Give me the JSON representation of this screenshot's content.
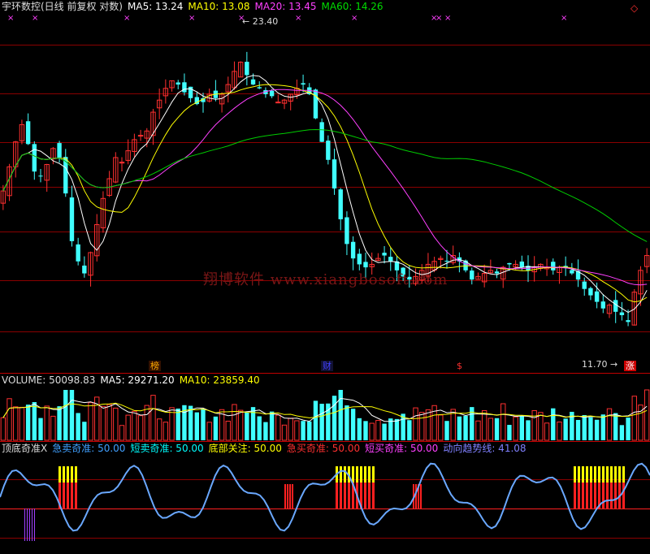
{
  "main": {
    "stock_title": "宇环数控(日线 前复权 对数)",
    "ma5_label": "MA5: 13.24",
    "ma10_label": "MA10: 13.08",
    "ma20_label": "MA20: 13.45",
    "ma60_label": "MA60: 14.26",
    "high_label": "23.40",
    "low_label": "11.70",
    "watermark": "翔博软件 www.xiangbosoft.com",
    "tag_bang": "榜",
    "tag_cai": "财",
    "tag_s": "$",
    "tag_zhang": "涨",
    "x_marker": "×",
    "colors": {
      "up": "#ff3030",
      "down": "#40ffff",
      "ma5": "#ffffff",
      "ma10": "#ffff00",
      "ma20": "#ff40ff",
      "ma60": "#00cc00"
    }
  },
  "volume": {
    "volume_label": "VOLUME: 50098.83",
    "ma5_label": "MA5: 29271.20",
    "ma10_label": "MA10: 23859.40"
  },
  "indicator": {
    "name_label": "顶底奇准X",
    "l1": "急卖奇准: 50.00",
    "l2": "短卖奇准: 50.00",
    "l3": "底部关注: 50.00",
    "l4": "急买奇准: 50.00",
    "l5": "短买奇准: 50.00",
    "l6": "动向趋势线: 41.08"
  },
  "chart_data": [
    {
      "type": "candlestick",
      "title": "宇环数控(日线 前复权 对数)",
      "series": [
        {
          "name": "MA5",
          "last": 13.24
        },
        {
          "name": "MA10",
          "last": 13.08
        },
        {
          "name": "MA20",
          "last": 13.45
        },
        {
          "name": "MA60",
          "last": 14.26
        }
      ],
      "annotations": [
        "23.40",
        "11.70"
      ],
      "close": [
        16.2,
        17.2,
        18.3,
        19.1,
        18.2,
        17.0,
        16.8,
        17.3,
        18.0,
        17.6,
        16.1,
        14.3,
        13.6,
        13.2,
        13.9,
        14.9,
        15.9,
        16.7,
        17.6,
        17.4,
        17.9,
        18.4,
        18.6,
        18.8,
        19.7,
        20.3,
        20.9,
        21.3,
        21.1,
        20.7,
        20.4,
        20.1,
        20.2,
        20.6,
        20.4,
        20.6,
        21.1,
        21.8,
        22.3,
        21.6,
        21.1,
        20.9,
        20.6,
        20.5,
        20.2,
        20.3,
        20.6,
        20.9,
        21.1,
        20.6,
        19.4,
        18.3,
        17.5,
        16.3,
        15.1,
        14.2,
        13.7,
        13.5,
        13.4,
        13.5,
        13.7,
        13.8,
        13.6,
        13.3,
        13.1,
        13.0,
        13.1,
        13.3,
        13.5,
        13.6,
        13.7,
        13.6,
        13.8,
        13.6,
        13.3,
        13.0,
        13.1,
        13.2,
        13.3,
        13.2,
        13.4,
        13.5,
        13.5,
        13.4,
        13.3,
        13.4,
        13.5,
        13.4,
        13.3,
        13.4,
        13.4,
        13.2,
        13.0,
        12.7,
        12.5,
        12.3,
        12.1,
        12.2,
        12.0,
        11.9,
        11.7,
        12.6,
        13.3,
        13.8
      ]
    },
    {
      "type": "bar",
      "title": "VOLUME",
      "series": [
        {
          "name": "VOLUME",
          "last": 50098.83
        },
        {
          "name": "MA5",
          "last": 29271.2
        },
        {
          "name": "MA10",
          "last": 23859.4
        }
      ]
    },
    {
      "type": "line",
      "title": "顶底奇准X",
      "series": [
        {
          "name": "急卖奇准",
          "last": 50.0
        },
        {
          "name": "短卖奇准",
          "last": 50.0
        },
        {
          "name": "底部关注",
          "last": 50.0
        },
        {
          "name": "急买奇准",
          "last": 50.0
        },
        {
          "name": "短买奇准",
          "last": 50.0
        },
        {
          "name": "动向趋势线",
          "last": 41.08
        }
      ]
    }
  ]
}
